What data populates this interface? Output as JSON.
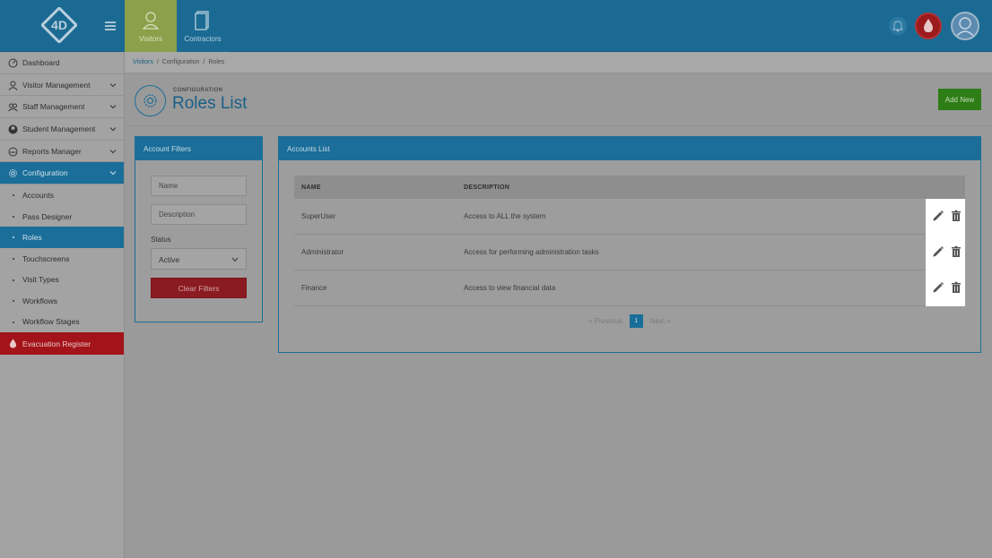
{
  "topbar": {
    "nav": [
      {
        "label": "Visitors",
        "icon": "visitor-icon"
      },
      {
        "label": "Contractors",
        "icon": "document-icon"
      }
    ],
    "icons": [
      "bell-icon",
      "evacuation-drop-icon",
      "user-avatar-icon"
    ]
  },
  "sidebar": {
    "items": [
      {
        "label": "Dashboard",
        "icon": "dashboard-icon"
      },
      {
        "label": "Visitor Management",
        "icon": "person-icon"
      },
      {
        "label": "Staff Management",
        "icon": "group-icon"
      },
      {
        "label": "Student Management",
        "icon": "student-icon"
      },
      {
        "label": "Reports Manager",
        "icon": "gauge-icon"
      },
      {
        "label": "Configuration",
        "icon": "gear-icon"
      }
    ],
    "sub_items": [
      "Accounts",
      "Pass Designer",
      "Roles",
      "Touchscreens",
      "Visit Types",
      "Workflows",
      "Workflow Stages"
    ],
    "evacuation": "Evacuation Register"
  },
  "breadcrumb": {
    "link": "Visitors",
    "sep1": "/",
    "middle": "Configuration",
    "sep2": "/",
    "current": "Roles"
  },
  "page": {
    "section": "CONFIGURATION",
    "title": "Roles List",
    "add_button": "Add New"
  },
  "filters": {
    "header": "Account Filters",
    "name_placeholder": "Name",
    "description_placeholder": "Description",
    "status_label": "Status",
    "status_value": "Active",
    "clear_button": "Clear Filters"
  },
  "accounts": {
    "header": "Accounts List",
    "columns": [
      "NAME",
      "DESCRIPTION"
    ],
    "rows": [
      {
        "name": "SuperUser",
        "description": "Access to ALL the system"
      },
      {
        "name": "Administrator",
        "description": "Access for performing administration tasks"
      },
      {
        "name": "Finance",
        "description": "Access to view financial data"
      }
    ],
    "pager": {
      "prev": "«  Previous",
      "page": "1",
      "next": "Next  »"
    }
  },
  "colors": {
    "brand_blue": "#1a6e99",
    "visitors_green": "#8aa04a",
    "add_green": "#2e7d17",
    "clear_red": "#8a1b22",
    "evac_red": "#a3141a"
  }
}
